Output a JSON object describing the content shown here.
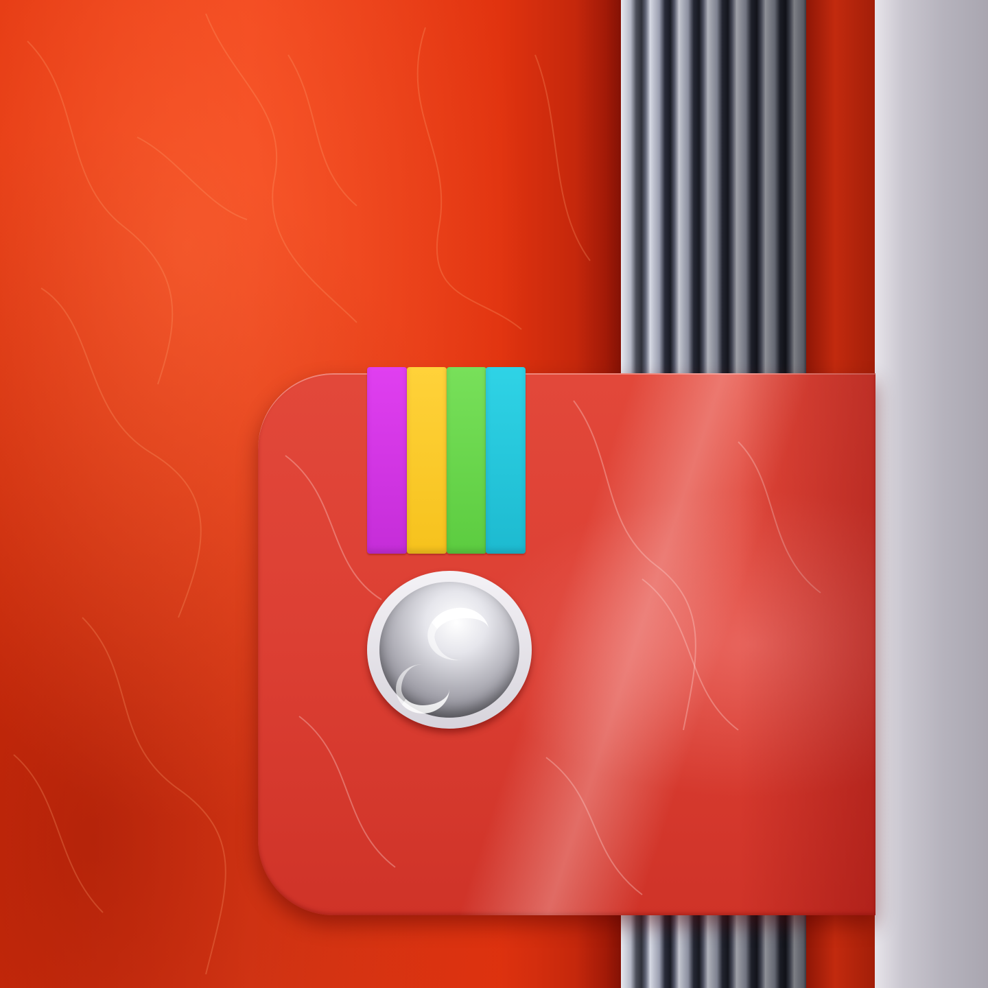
{
  "app_icon": {
    "name": "Instagram",
    "style": "leather notebook camera icon",
    "background_color": "#e2340e",
    "clasp_color": "#dc3f33",
    "lens_color": "#d7d4dc",
    "stripes": [
      {
        "name": "magenta",
        "color": "#e03ff0"
      },
      {
        "name": "yellow",
        "color": "#ffd23a"
      },
      {
        "name": "green",
        "color": "#78e05a"
      },
      {
        "name": "cyan",
        "color": "#2fd3e6"
      }
    ]
  }
}
